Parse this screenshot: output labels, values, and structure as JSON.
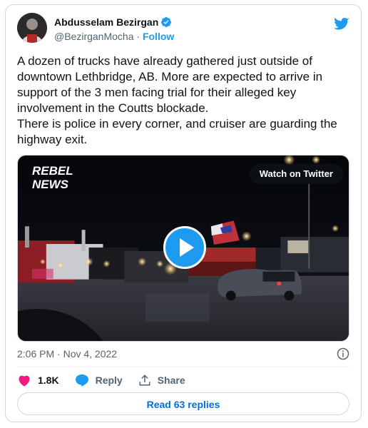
{
  "author": {
    "name": "Abdusselam Bezirgan",
    "handle": "@BezirganMocha",
    "separator": " · ",
    "follow_label": "Follow"
  },
  "tweet": {
    "line1": "A dozen of trucks have already gathered just outside of downtown Lethbridge, AB. More are expected to arrive in support of the 3 men facing trial for their alleged key involvement in the Coutts blockade.",
    "line2": "There is police in every corner, and cruiser are guarding the highway exit."
  },
  "video": {
    "logo_line1": "REBEL",
    "logo_line2": "NEWS",
    "watch_label": "Watch on Twitter"
  },
  "meta": {
    "timestamp": "2:06 PM · Nov 4, 2022"
  },
  "actions": {
    "like_count": "1.8K",
    "reply_label": "Reply",
    "share_label": "Share"
  },
  "footer": {
    "read_replies_label": "Read 63 replies"
  },
  "colors": {
    "accent": "#1d9bf0",
    "like": "#f91880",
    "link": "#006fd6"
  },
  "icons": [
    "verified-badge-icon",
    "twitter-bird-icon",
    "play-icon",
    "info-icon",
    "heart-icon",
    "reply-bubble-icon",
    "share-icon"
  ]
}
